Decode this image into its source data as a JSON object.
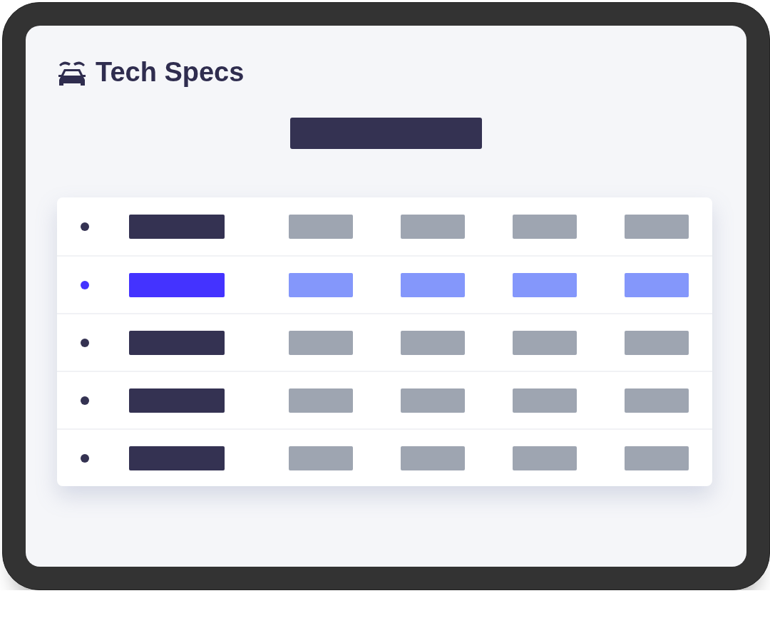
{
  "title": "Tech Specs",
  "rows": [
    {
      "selected": false
    },
    {
      "selected": true
    },
    {
      "selected": false
    },
    {
      "selected": false
    },
    {
      "selected": false
    }
  ]
}
